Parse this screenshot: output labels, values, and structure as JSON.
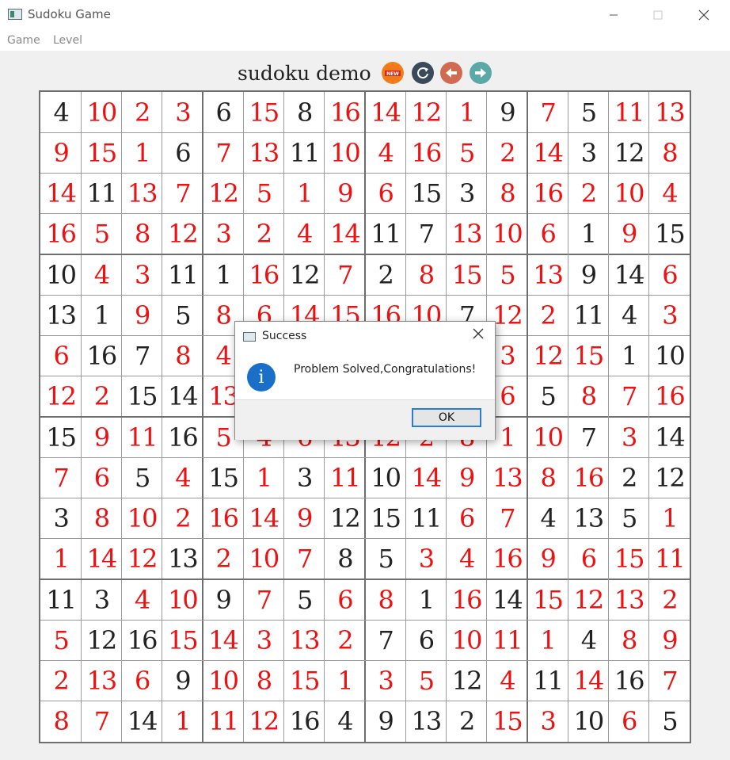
{
  "window": {
    "title": "Sudoku Game"
  },
  "menu": [
    "Game",
    "Level"
  ],
  "toolbar": {
    "title": "sudoku demo",
    "buttons": [
      {
        "name": "new-game-button",
        "icon": "new-badge-icon",
        "label": "NEW",
        "color": "#f08020"
      },
      {
        "name": "restart-button",
        "icon": "refresh-icon",
        "color": "#3a4a5a"
      },
      {
        "name": "undo-button",
        "icon": "arrow-left-icon",
        "color": "#d06a50"
      },
      {
        "name": "redo-button",
        "icon": "arrow-right-icon",
        "color": "#5aa8a8"
      }
    ]
  },
  "board": {
    "size": 16,
    "rows": [
      [
        "4",
        "10",
        "2",
        "3",
        "6",
        "15",
        "8",
        "16",
        "14",
        "12",
        "1",
        "9",
        "7",
        "5",
        "11",
        "13"
      ],
      [
        "9",
        "15",
        "1",
        "6",
        "7",
        "13",
        "11",
        "10",
        "4",
        "16",
        "5",
        "2",
        "14",
        "3",
        "12",
        "8"
      ],
      [
        "14",
        "11",
        "13",
        "7",
        "12",
        "5",
        "1",
        "9",
        "6",
        "15",
        "3",
        "8",
        "16",
        "2",
        "10",
        "4"
      ],
      [
        "16",
        "5",
        "8",
        "12",
        "3",
        "2",
        "4",
        "14",
        "11",
        "7",
        "13",
        "10",
        "6",
        "1",
        "9",
        "15"
      ],
      [
        "10",
        "4",
        "3",
        "11",
        "1",
        "16",
        "12",
        "7",
        "2",
        "8",
        "15",
        "5",
        "13",
        "9",
        "14",
        "6"
      ],
      [
        "13",
        "1",
        "9",
        "5",
        "8",
        "6",
        "14",
        "15",
        "16",
        "10",
        "7",
        "12",
        "2",
        "11",
        "4",
        "3"
      ],
      [
        "6",
        "16",
        "7",
        "8",
        "4",
        "",
        "",
        "",
        "",
        "",
        "",
        "3",
        "12",
        "15",
        "1",
        "10"
      ],
      [
        "12",
        "2",
        "15",
        "14",
        "13",
        "",
        "",
        "",
        "",
        "",
        "",
        "6",
        "5",
        "8",
        "7",
        "16"
      ],
      [
        "15",
        "9",
        "11",
        "16",
        "5",
        "4",
        "6",
        "13",
        "12",
        "2",
        "8",
        "1",
        "10",
        "7",
        "3",
        "14"
      ],
      [
        "7",
        "6",
        "5",
        "4",
        "15",
        "1",
        "3",
        "11",
        "10",
        "14",
        "9",
        "13",
        "8",
        "16",
        "2",
        "12"
      ],
      [
        "3",
        "8",
        "10",
        "2",
        "16",
        "14",
        "9",
        "12",
        "15",
        "11",
        "6",
        "7",
        "4",
        "13",
        "5",
        "1"
      ],
      [
        "1",
        "14",
        "12",
        "13",
        "2",
        "10",
        "7",
        "8",
        "5",
        "3",
        "4",
        "16",
        "9",
        "6",
        "15",
        "11"
      ],
      [
        "11",
        "3",
        "4",
        "10",
        "9",
        "7",
        "5",
        "6",
        "8",
        "1",
        "16",
        "14",
        "15",
        "12",
        "13",
        "2"
      ],
      [
        "5",
        "12",
        "16",
        "15",
        "14",
        "3",
        "13",
        "2",
        "7",
        "6",
        "10",
        "11",
        "1",
        "4",
        "8",
        "9"
      ],
      [
        "2",
        "13",
        "6",
        "9",
        "10",
        "8",
        "15",
        "1",
        "3",
        "5",
        "12",
        "4",
        "11",
        "14",
        "16",
        "7"
      ],
      [
        "8",
        "7",
        "14",
        "1",
        "11",
        "12",
        "16",
        "4",
        "9",
        "13",
        "2",
        "15",
        "3",
        "10",
        "6",
        "5"
      ]
    ],
    "given": [
      "1000101000010100",
      "0001001000000110",
      "0100000001100000",
      "0000000011000101",
      "1001101010000110",
      "1101000000100110",
      "0110000000000011",
      "0011000000001000",
      "1001000000000101",
      "0010101010000011",
      "1000000111001110",
      "0001000110000000",
      "1100101001010000",
      "0110000011000100",
      "0001000000101010",
      "0010001111100101"
    ],
    "given_color": "#222222",
    "filled_color": "#ee1111"
  },
  "dialog": {
    "title": "Success",
    "message": "Problem Solved,Congratulations!",
    "ok_label": "OK",
    "icon": "info-icon"
  }
}
